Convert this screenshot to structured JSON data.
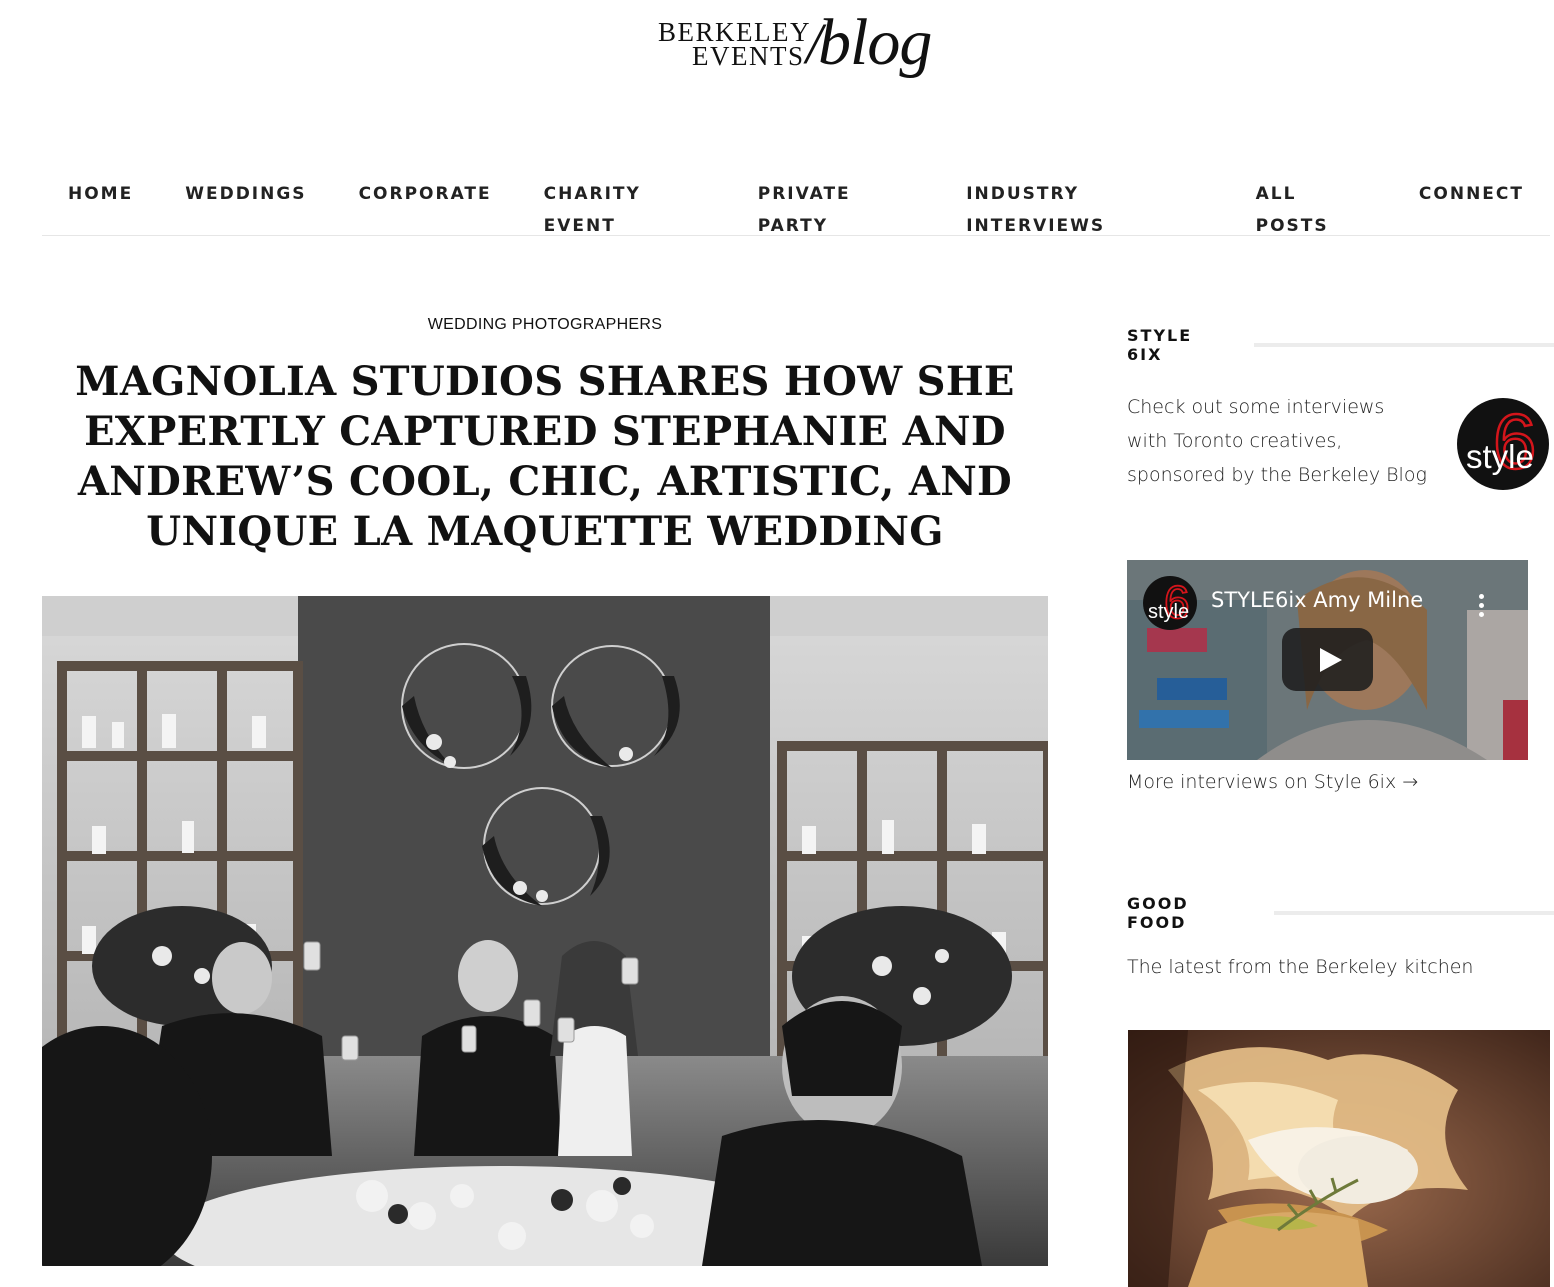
{
  "logo": {
    "line1": "BERKELEY",
    "line2": "EVENTS",
    "slash": "/",
    "script": "blog"
  },
  "nav": {
    "items": [
      "HOME",
      "WEDDINGS",
      "CORPORATE",
      "CHARITY EVENT",
      "PRIVATE PARTY",
      "INDUSTRY INTERVIEWS",
      "ALL POSTS",
      "CONNECT"
    ]
  },
  "article": {
    "category": "WEDDING PHOTOGRAPHERS",
    "title": "MAGNOLIA STUDIOS SHARES HOW SHE EXPERTLY CAPTURED STEPHANIE AND ANDREW’S COOL, CHIC, ARTISTIC, AND UNIQUE LA MAQUETTE WEDDING"
  },
  "sidebar": {
    "style6ix": {
      "heading": "STYLE 6IX",
      "text": "Check out some interviews with Toronto creatives, sponsored by the Berkeley Blog",
      "badge_numeral": "6",
      "badge_word": "style",
      "video_title": "STYLE6ix Amy Milne",
      "more_link": "More interviews on Style 6ix →"
    },
    "good_food": {
      "heading": "GOOD FOOD",
      "text": "The latest from the Berkeley kitchen"
    }
  },
  "colors": {
    "accent_red": "#d4151b",
    "text": "#111111",
    "divider": "#ececec"
  }
}
